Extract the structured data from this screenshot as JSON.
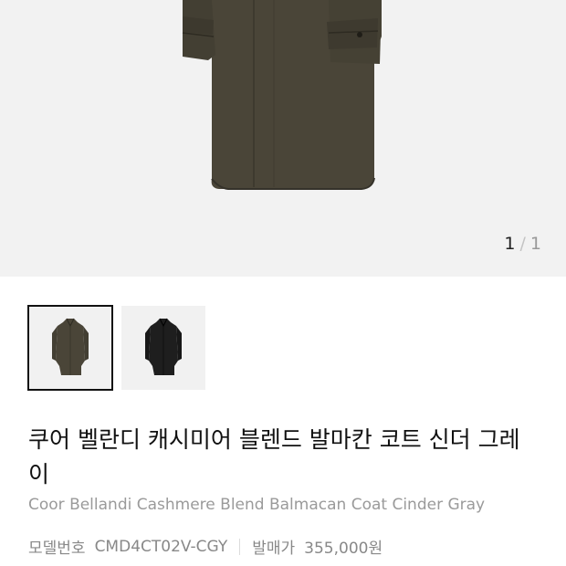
{
  "gallery": {
    "current": "1",
    "separator": "/",
    "total": "1",
    "main_image_icon": "coat-photo",
    "thumbnails": [
      {
        "icon": "olive-coat-thumbnail",
        "active": true,
        "color": "#4a4538"
      },
      {
        "icon": "black-coat-thumbnail",
        "active": false,
        "color": "#1e1e1e"
      }
    ]
  },
  "product": {
    "title": "쿠어 벨란디 캐시미어 블렌드 발마칸 코트 신더 그레이",
    "subtitle": "Coor Bellandi Cashmere Blend Balmacan Coat Cinder Gray",
    "model_label": "모델번호",
    "model_value": "CMD4CT02V-CGY",
    "price_label": "발매가",
    "price_value": "355,000원"
  },
  "colors": {
    "coat": "#4a4538",
    "background": "#f2f2f2"
  }
}
